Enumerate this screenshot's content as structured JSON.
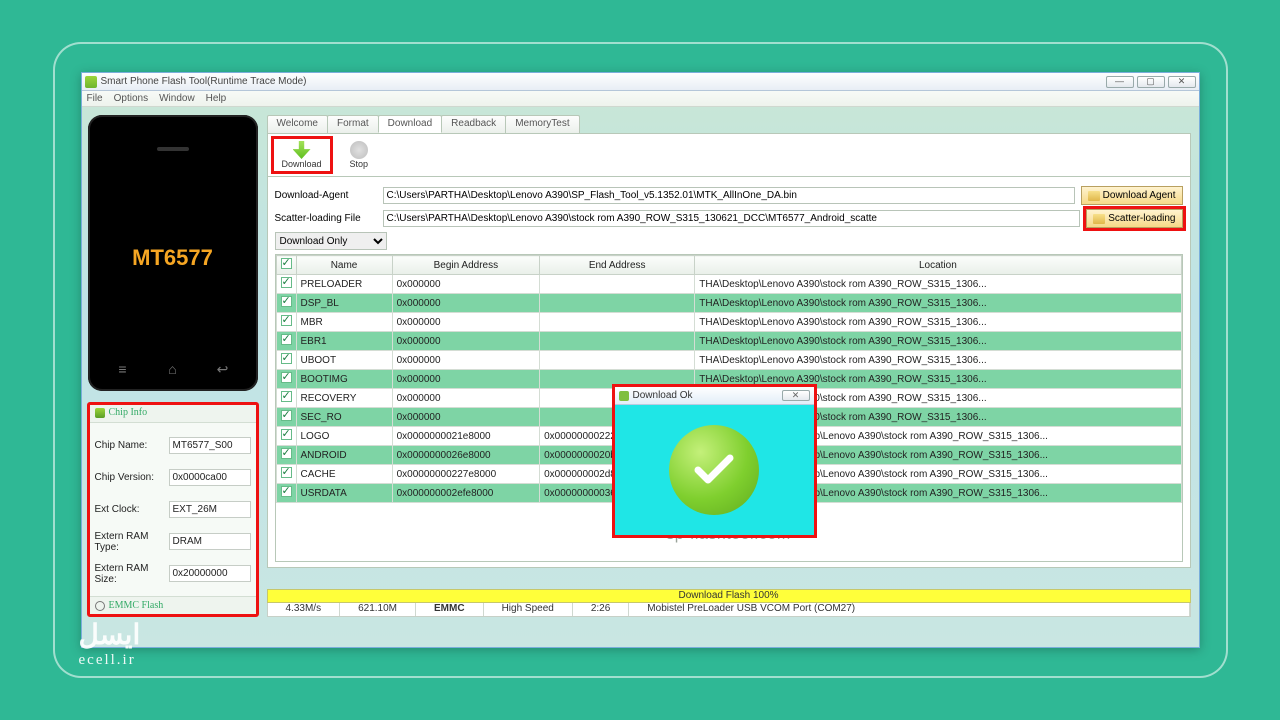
{
  "window": {
    "title": "Smart Phone Flash Tool(Runtime Trace Mode)"
  },
  "menu": {
    "file": "File",
    "options": "Options",
    "window": "Window",
    "help": "Help"
  },
  "phone": {
    "chip": "MT6577"
  },
  "chipinfo": {
    "heading": "Chip Info",
    "items": {
      "chip_name_l": "Chip Name:",
      "chip_name": "MT6577_S00",
      "chip_ver_l": "Chip Version:",
      "chip_ver": "0x0000ca00",
      "ext_clock_l": "Ext Clock:",
      "ext_clock": "EXT_26M",
      "ram_type_l": "Extern RAM Type:",
      "ram_type": "DRAM",
      "ram_size_l": "Extern RAM Size:",
      "ram_size": "0x20000000"
    },
    "emmc": "EMMC Flash"
  },
  "tabs": {
    "welcome": "Welcome",
    "format": "Format",
    "download": "Download",
    "readback": "Readback",
    "memorytest": "MemoryTest"
  },
  "toolbar": {
    "download": "Download",
    "stop": "Stop"
  },
  "form": {
    "agent_l": "Download-Agent",
    "agent": "C:\\Users\\PARTHA\\Desktop\\Lenovo A390\\SP_Flash_Tool_v5.1352.01\\MTK_AllInOne_DA.bin",
    "agent_btn": "Download Agent",
    "scatter_l": "Scatter-loading File",
    "scatter": "C:\\Users\\PARTHA\\Desktop\\Lenovo A390\\stock rom A390_ROW_S315_130621_DCC\\MT6577_Android_scatte",
    "scatter_btn": "Scatter-loading",
    "mode": "Download Only"
  },
  "headers": {
    "name": "Name",
    "begin": "Begin Address",
    "end": "End Address",
    "loc": "Location"
  },
  "rows": [
    {
      "name": "PRELOADER",
      "begin": "0x000000",
      "end": "",
      "loc": "THA\\Desktop\\Lenovo A390\\stock rom A390_ROW_S315_1306...",
      "g": false
    },
    {
      "name": "DSP_BL",
      "begin": "0x000000",
      "end": "",
      "loc": "THA\\Desktop\\Lenovo A390\\stock rom A390_ROW_S315_1306...",
      "g": true
    },
    {
      "name": "MBR",
      "begin": "0x000000",
      "end": "",
      "loc": "THA\\Desktop\\Lenovo A390\\stock rom A390_ROW_S315_1306...",
      "g": false
    },
    {
      "name": "EBR1",
      "begin": "0x000000",
      "end": "",
      "loc": "THA\\Desktop\\Lenovo A390\\stock rom A390_ROW_S315_1306...",
      "g": true
    },
    {
      "name": "UBOOT",
      "begin": "0x000000",
      "end": "",
      "loc": "THA\\Desktop\\Lenovo A390\\stock rom A390_ROW_S315_1306...",
      "g": false
    },
    {
      "name": "BOOTIMG",
      "begin": "0x000000",
      "end": "",
      "loc": "THA\\Desktop\\Lenovo A390\\stock rom A390_ROW_S315_1306...",
      "g": true
    },
    {
      "name": "RECOVERY",
      "begin": "0x000000",
      "end": "",
      "loc": "THA\\Desktop\\Lenovo A390\\stock rom A390_ROW_S315_1306...",
      "g": false
    },
    {
      "name": "SEC_RO",
      "begin": "0x000000",
      "end": "",
      "loc": "THA\\Desktop\\Lenovo A390\\stock rom A390_ROW_S315_1306...",
      "g": true
    },
    {
      "name": "LOGO",
      "begin": "0x0000000021e8000",
      "end": "0x00000000222b6c1",
      "loc": "C:\\Users\\PARTHA\\Desktop\\Lenovo A390\\stock rom A390_ROW_S315_1306...",
      "g": false
    },
    {
      "name": "ANDROID",
      "begin": "0x0000000026e8000",
      "end": "0x0000000020b008f7",
      "loc": "C:\\Users\\PARTHA\\Desktop\\Lenovo A390\\stock rom A390_ROW_S315_1306...",
      "g": true
    },
    {
      "name": "CACHE",
      "begin": "0x00000000227e8000",
      "end": "0x000000002d8f0c3",
      "loc": "C:\\Users\\PARTHA\\Desktop\\Lenovo A390\\stock rom A390_ROW_S315_1306...",
      "g": false
    },
    {
      "name": "USRDATA",
      "begin": "0x000000002efe8000",
      "end": "0x00000000036665213",
      "loc": "C:\\Users\\PARTHA\\Desktop\\Lenovo A390\\stock rom A390_ROW_S315_1306...",
      "g": true
    }
  ],
  "site": "sp-flashtool.com",
  "status": {
    "progress": "Download Flash 100%",
    "speed": "4.33M/s",
    "total": "621.10M",
    "emmc": "EMMC",
    "mode": "High Speed",
    "time": "2:26",
    "port": "Mobistel PreLoader USB VCOM Port (COM27)"
  },
  "dialog": {
    "title": "Download Ok"
  },
  "watermark": {
    "brand": "ایسل",
    "url": "ecell.ir"
  }
}
